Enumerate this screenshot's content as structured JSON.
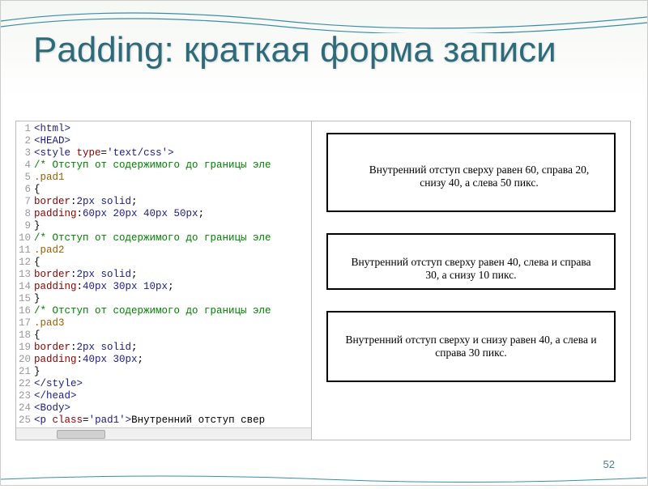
{
  "title": "Padding: краткая форма записи",
  "slide_number": "52",
  "code": {
    "lines": [
      {
        "n": "1",
        "html": "<span class='t-tag'>&lt;html&gt;</span>"
      },
      {
        "n": "2",
        "html": "<span class='t-tag'>&lt;HEAD&gt;</span>"
      },
      {
        "n": "3",
        "html": "<span class='t-tag'>&lt;style</span> <span class='t-attr'>type</span>=<span class='t-val'>'text/css'</span><span class='t-tag'>&gt;</span>"
      },
      {
        "n": "4",
        "html": "<span class='t-comment'>/* Отступ от содержимого до границы эле</span>"
      },
      {
        "n": "5",
        "html": "<span class='t-sel'>.pad1</span>"
      },
      {
        "n": "6",
        "html": "<span class='t-punc'>{</span>"
      },
      {
        "n": "7",
        "html": "<span class='t-prop'>border</span>:<span class='t-value'>2px solid</span>;"
      },
      {
        "n": "8",
        "html": "<span class='t-prop'>padding</span>:<span class='t-value'>60px 20px 40px 50px</span>;"
      },
      {
        "n": "9",
        "html": "<span class='t-punc'>}</span>"
      },
      {
        "n": "10",
        "html": "<span class='t-comment'>/* Отступ от содержимого до границы эле</span>"
      },
      {
        "n": "11",
        "html": "<span class='t-sel'>.pad2</span>"
      },
      {
        "n": "12",
        "html": "<span class='t-punc'>{</span>"
      },
      {
        "n": "13",
        "html": "<span class='t-prop'>border</span>:<span class='t-value'>2px solid</span>;"
      },
      {
        "n": "14",
        "html": "<span class='t-prop'>padding</span>:<span class='t-value'>40px 30px 10px</span>;"
      },
      {
        "n": "15",
        "html": "<span class='t-punc'>}</span>"
      },
      {
        "n": "16",
        "html": "<span class='t-comment'>/* Отступ от содержимого до границы эле</span>"
      },
      {
        "n": "17",
        "html": "<span class='t-sel'>.pad3</span>"
      },
      {
        "n": "18",
        "html": "<span class='t-punc'>{</span>"
      },
      {
        "n": "19",
        "html": "<span class='t-prop'>border</span>:<span class='t-value'>2px solid</span>;"
      },
      {
        "n": "20",
        "html": "<span class='t-prop'>padding</span>:<span class='t-value'>40px 30px</span>;"
      },
      {
        "n": "21",
        "html": "<span class='t-punc'>}</span>"
      },
      {
        "n": "22",
        "html": "<span class='t-tag'>&lt;/style&gt;</span>"
      },
      {
        "n": "23",
        "html": "<span class='t-tag'>&lt;/head&gt;</span>"
      },
      {
        "n": "24",
        "html": "<span class='t-tag'>&lt;Body&gt;</span>"
      },
      {
        "n": "25",
        "html": "<span class='t-tag'>&lt;p</span> <span class='t-attr'>class</span>=<span class='t-val'>'pad1'</span><span class='t-tag'>&gt;</span>Внутренний отступ свер"
      }
    ]
  },
  "boxes": {
    "pad1": "Внутренний отступ сверху равен 60, справа 20, снизу 40, а слева 50 пикс.",
    "pad2": "Внутренний отступ сверху равен 40, слева и справа 30, а снизу 10 пикс.",
    "pad3": "Внутренний отступ сверху и снизу равен 40, а слева и справа 30 пикс."
  }
}
